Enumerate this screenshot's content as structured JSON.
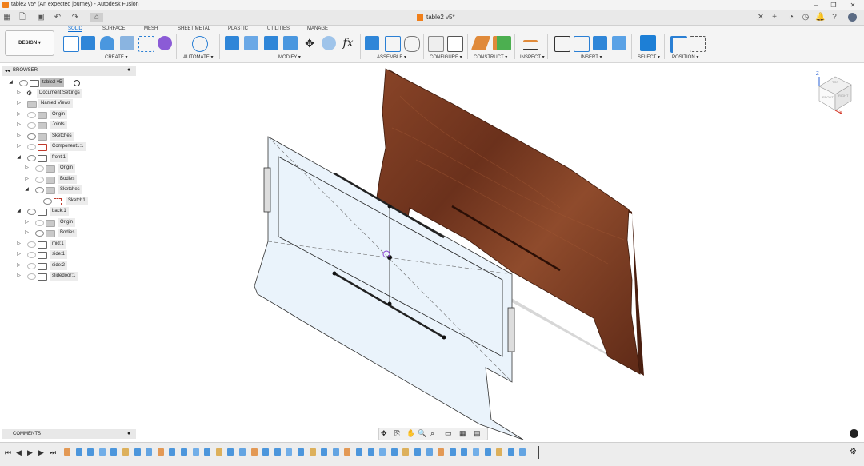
{
  "window": {
    "title": "table2 v5* (An expected journey) - Autodesk Fusion",
    "doc_tab": "table2 v5*"
  },
  "ribbon": {
    "workspace": "DESIGN ▾",
    "tabs": [
      "SOLID",
      "SURFACE",
      "MESH",
      "SHEET METAL",
      "PLASTIC",
      "UTILITIES",
      "MANAGE"
    ],
    "groups": [
      "CREATE ▾",
      "AUTOMATE ▾",
      "MODIFY ▾",
      "ASSEMBLE ▾",
      "CONFIGURE ▾",
      "CONSTRUCT ▾",
      "INSPECT ▾",
      "INSERT ▾",
      "SELECT ▾",
      "POSITION ▾"
    ]
  },
  "browser": {
    "title": "BROWSER",
    "root": "table2 v5",
    "items": [
      {
        "label": "Document Settings"
      },
      {
        "label": "Named Views"
      },
      {
        "label": "Origin"
      },
      {
        "label": "Joints"
      },
      {
        "label": "Sketches"
      },
      {
        "label": "Component1:1"
      },
      {
        "label": "front:1"
      },
      {
        "label": "Origin"
      },
      {
        "label": "Bodies"
      },
      {
        "label": "Sketches"
      },
      {
        "label": "Sketch1"
      },
      {
        "label": "back:1"
      },
      {
        "label": "Origin"
      },
      {
        "label": "Bodies"
      },
      {
        "label": "mid:1"
      },
      {
        "label": "side:1"
      },
      {
        "label": "side:2"
      },
      {
        "label": "slidedoor:1"
      }
    ]
  },
  "comments": {
    "title": "COMMENTS"
  },
  "viewcube": {
    "top": "TOP",
    "front": "FRONT",
    "right": "RIGHT",
    "z": "Z",
    "x": "X"
  },
  "colors": {
    "accent": "#0a6bd1",
    "wood": "#7a3a22",
    "panel": "#eaf3fb"
  }
}
